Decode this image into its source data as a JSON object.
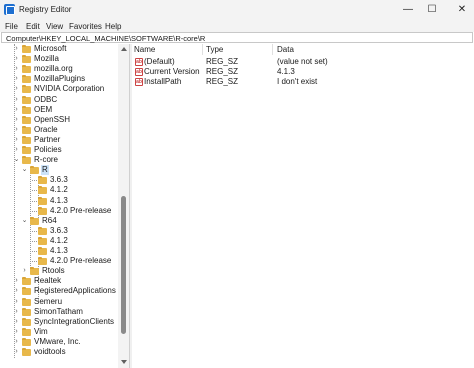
{
  "window": {
    "title": "Registry Editor",
    "controls": {
      "minimize": "—",
      "maximize": "☐",
      "close": "✕"
    }
  },
  "menu": [
    "File",
    "Edit",
    "View",
    "Favorites",
    "Help"
  ],
  "address": "Computer\\HKEY_LOCAL_MACHINE\\SOFTWARE\\R-core\\R",
  "tree": [
    {
      "label": "Microsoft",
      "expander": "›"
    },
    {
      "label": "Mozilla",
      "expander": "›"
    },
    {
      "label": "mozilla.org",
      "expander": "›"
    },
    {
      "label": "MozillaPlugins",
      "expander": "›"
    },
    {
      "label": "NVIDIA Corporation",
      "expander": "›"
    },
    {
      "label": "ODBC",
      "expander": "›"
    },
    {
      "label": "OEM",
      "expander": "›"
    },
    {
      "label": "OpenSSH",
      "expander": "›"
    },
    {
      "label": "Oracle",
      "expander": "›"
    },
    {
      "label": "Partner",
      "expander": "›"
    },
    {
      "label": "Policies",
      "expander": "›"
    },
    {
      "label": "R-core",
      "expander": "⌄"
    },
    {
      "label": "R",
      "expander": "⌄",
      "selected": true
    },
    {
      "label": "3.6.3",
      "expander": ""
    },
    {
      "label": "4.1.2",
      "expander": ""
    },
    {
      "label": "4.1.3",
      "expander": ""
    },
    {
      "label": "4.2.0 Pre-release",
      "expander": ""
    },
    {
      "label": "R64",
      "expander": "⌄"
    },
    {
      "label": "3.6.3",
      "expander": ""
    },
    {
      "label": "4.1.2",
      "expander": ""
    },
    {
      "label": "4.1.3",
      "expander": ""
    },
    {
      "label": "4.2.0 Pre-release",
      "expander": ""
    },
    {
      "label": "Rtools",
      "expander": "›"
    },
    {
      "label": "Realtek",
      "expander": "›"
    },
    {
      "label": "RegisteredApplications",
      "expander": "›"
    },
    {
      "label": "Semeru",
      "expander": "›"
    },
    {
      "label": "SimonTatham",
      "expander": "›"
    },
    {
      "label": "SyncIntegrationClients",
      "expander": "›"
    },
    {
      "label": "Vim",
      "expander": "›"
    },
    {
      "label": "VMware, Inc.",
      "expander": "›"
    },
    {
      "label": "voidtools",
      "expander": "›"
    }
  ],
  "list": {
    "columns": [
      "Name",
      "Type",
      "Data"
    ],
    "value_icon_text": "ab",
    "rows": [
      {
        "name": "(Default)",
        "type": "REG_SZ",
        "data": "(value not set)"
      },
      {
        "name": "Current Version",
        "type": "REG_SZ",
        "data": "4.1.3"
      },
      {
        "name": "InstallPath",
        "type": "REG_SZ",
        "data": "I don't exist"
      }
    ]
  },
  "colors": {
    "folder": "#e8b84a",
    "selection": "#cde3f7",
    "chrome": "#f3f3f3"
  }
}
